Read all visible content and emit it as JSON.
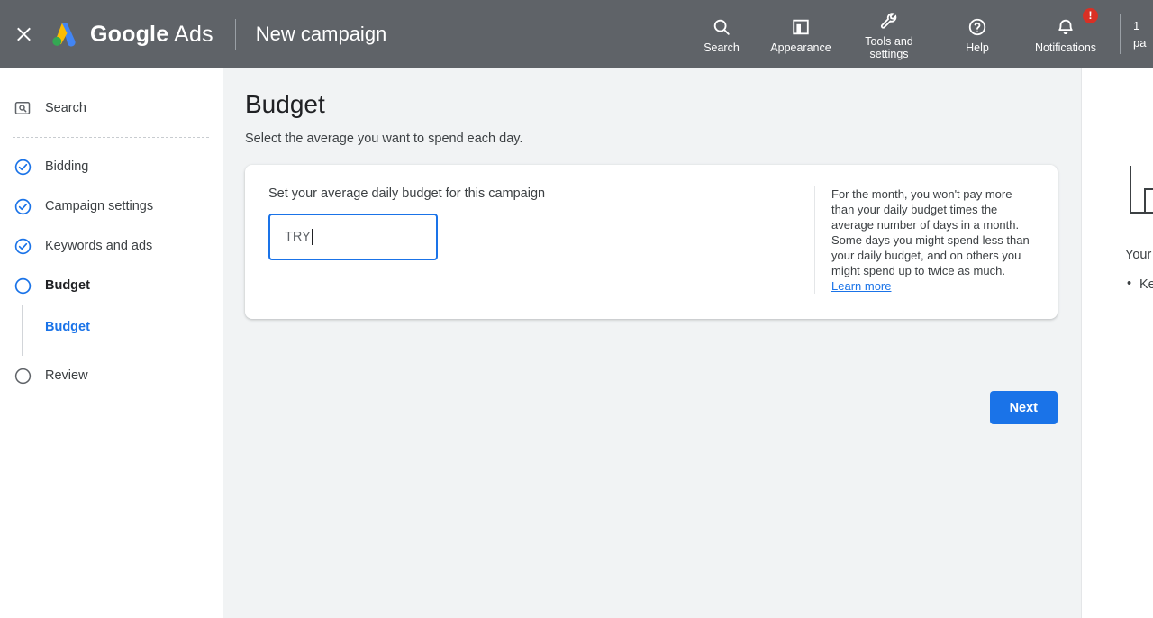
{
  "header": {
    "close_icon": "close-x-icon",
    "brand_bold": "Google",
    "brand_light": "Ads",
    "page_title": "New campaign",
    "tools": [
      {
        "label": "Search",
        "icon": "search-icon"
      },
      {
        "label": "Appearance",
        "icon": "appearance-icon"
      },
      {
        "label": "Tools and\nsettings",
        "icon": "wrench-icon"
      },
      {
        "label": "Help",
        "icon": "help-circle-icon"
      },
      {
        "label": "Notifications",
        "icon": "bell-icon",
        "badge": "!"
      }
    ],
    "account_clipped_line1": "1",
    "account_clipped_line2": "pa"
  },
  "sidebar": {
    "items": [
      {
        "label": "Search",
        "icon": "search-box-icon",
        "state": "plain",
        "bold": false
      },
      {
        "label": "Bidding",
        "icon": "check-circle-icon",
        "state": "complete",
        "bold": false
      },
      {
        "label": "Campaign settings",
        "icon": "check-circle-icon",
        "state": "complete",
        "bold": false
      },
      {
        "label": "Keywords and ads",
        "icon": "check-circle-icon",
        "state": "complete",
        "bold": false
      },
      {
        "label": "Budget",
        "icon": "circle-outline-icon",
        "state": "active",
        "bold": true
      },
      {
        "label": "Review",
        "icon": "circle-outline-icon",
        "state": "pending",
        "bold": false
      }
    ],
    "sub_item": "Budget"
  },
  "main": {
    "heading": "Budget",
    "subheading": "Select the average you want to spend each day.",
    "field_label": "Set your average daily budget for this campaign",
    "input_value": "TRY",
    "input_placeholder": "TRY",
    "help_text": "For the month, you won't pay more than your daily budget times the average number of days in a month. Some days you might spend less than your daily budget, and on others you might spend up to twice as much. ",
    "help_link": "Learn more",
    "next_label": "Next"
  },
  "right_panel": {
    "title": "Your estimates will be shown here",
    "bullet": "Keywords",
    "graphic": "chart-illustration"
  },
  "colors": {
    "header_bg": "#5f6368",
    "accent_blue": "#1a73e8",
    "badge_red": "#d93025",
    "page_bg": "#f1f3f4",
    "card_bg": "#ffffff",
    "text_primary": "#202124",
    "text_secondary": "#3c4043",
    "text_muted": "#5f6368"
  }
}
